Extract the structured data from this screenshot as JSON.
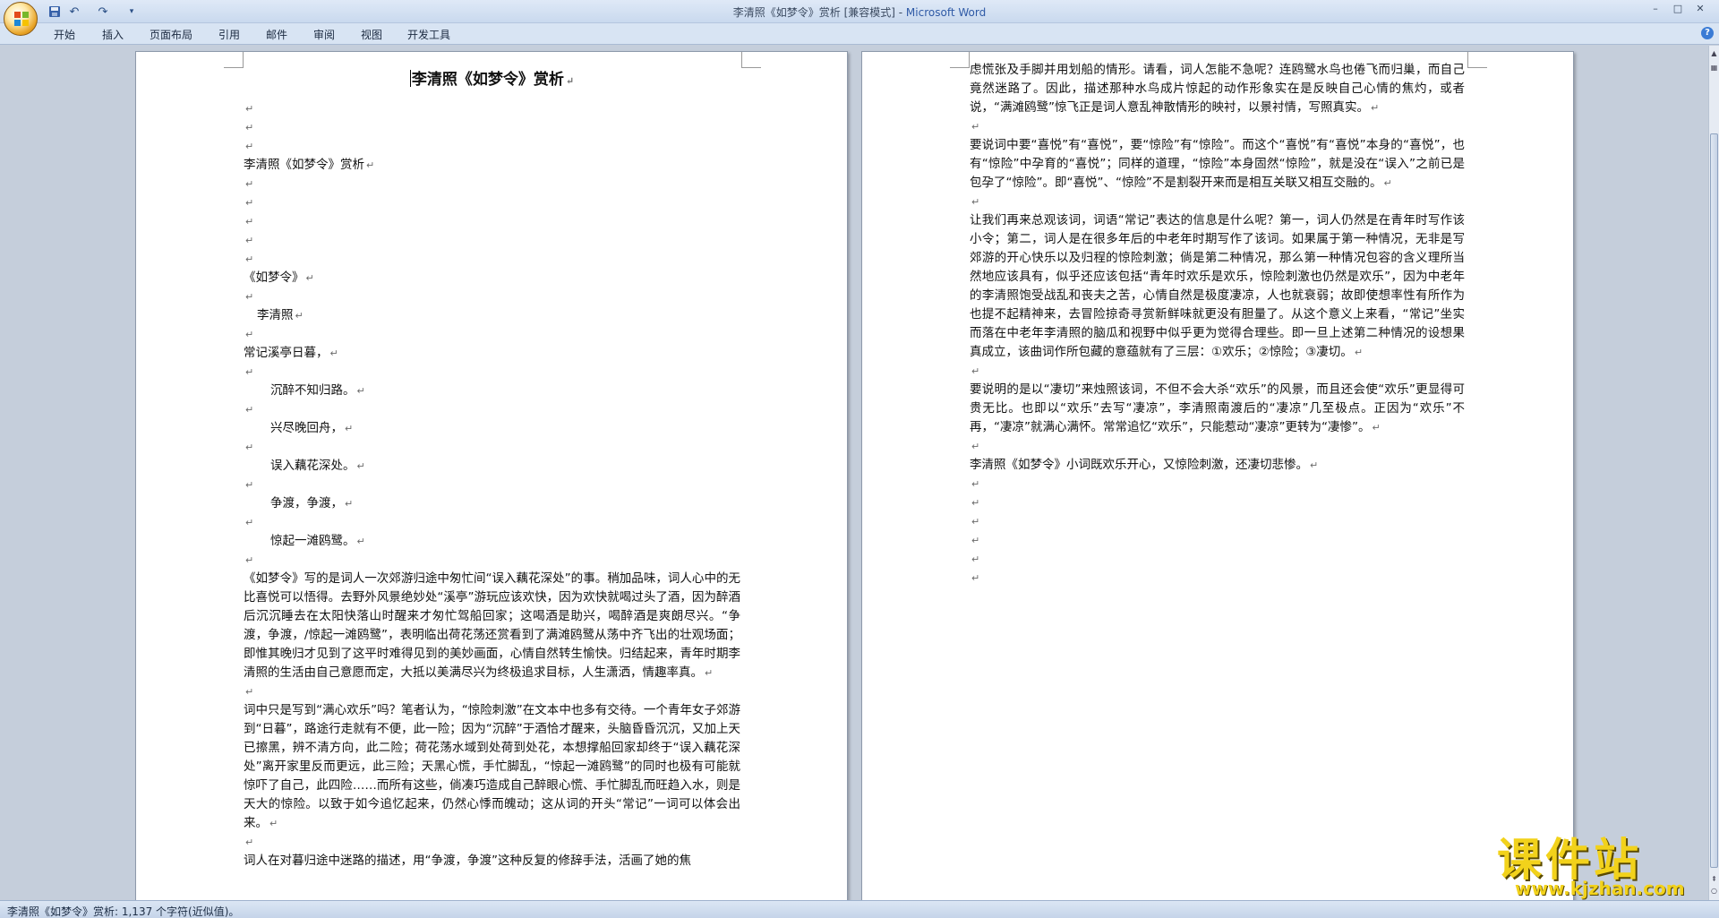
{
  "window": {
    "title": "李清照《如梦令》赏析 [兼容模式] - ",
    "app_name": "Microsoft Word",
    "min": "–",
    "max": "□",
    "close": "✕"
  },
  "quick_access": {
    "save_icon": "save-icon",
    "undo_icon": "undo-icon",
    "redo_icon": "redo-icon"
  },
  "tabs": [
    "开始",
    "插入",
    "页面布局",
    "引用",
    "邮件",
    "审阅",
    "视图",
    "开发工具"
  ],
  "document": {
    "heading": "李清照《如梦令》赏析",
    "subtitle_line": "李清照《如梦令》赏析",
    "poem_title": "《如梦令》",
    "author": "李清照",
    "poem_lines": [
      "常记溪亭日暮，",
      "沉醉不知归路。",
      "兴尽晚回舟，",
      "误入藕花深处。",
      "争渡，争渡，",
      "惊起一滩鸥鹭。"
    ],
    "para1": "《如梦令》写的是词人一次郊游归途中匆忙间“误入藕花深处”的事。稍加品味，词人心中的无比喜悦可以悟得。去野外风景绝妙处“溪亭”游玩应该欢快，因为欢快就喝过头了酒，因为醉酒后沉沉睡去在太阳快落山时醒来才匆忙驾船回家；这喝酒是助兴，喝醉酒是爽朗尽兴。“争渡，争渡，/惊起一滩鸥鹭”，表明临出荷花荡还赏看到了满滩鸥鹭从荡中齐飞出的壮观场面；即惟其晚归才见到了这平时难得见到的美妙画面，心情自然转生愉快。归结起来，青年时期李清照的生活由自己意愿而定，大抵以美满尽兴为终极追求目标，人生潇洒，情趣率真。",
    "para2": "词中只是写到“满心欢乐”吗？笔者认为，“惊险刺激”在文本中也多有交待。一个青年女子郊游到“日暮”，路途行走就有不便，此一险；因为“沉醉”于酒恰才醒来，头脑昏昏沉沉，又加上天已擦黑，辨不清方向，此二险；荷花荡水域到处荷到处花，本想撑船回家却终于“误入藕花深处”离开家里反而更远，此三险；天黑心慌，手忙脚乱，“惊起一滩鸥鹭”的同时也极有可能就惊吓了自己，此四险……而所有这些，倘凑巧造成自己醉眼心慌、手忙脚乱而旺趋入水，则是天大的惊险。以致于如今追忆起来，仍然心悸而魄动；这从词的开头“常记”一词可以体会出来。",
    "para3": "词人在对暮归途中迷路的描述，用“争渡，争渡”这种反复的修辞手法，活画了她的焦",
    "right_para0": "虑慌张及手脚并用划船的情形。请看，词人怎能不急呢？连鸥鹭水鸟也倦飞而归巢，而自己竟然迷路了。因此，描述那种水鸟成片惊起的动作形象实在是反映自己心情的焦灼，或者说，“满滩鸥鹭”惊飞正是词人意乱神散情形的映衬，以景衬情，写照真实。",
    "right_para1": "要说词中要“喜悦”有“喜悦”，要“惊险”有“惊险”。而这个“喜悦”有“喜悦”本身的“喜悦”，也有“惊险”中孕育的“喜悦”；同样的道理，“惊险”本身固然“惊险”，就是没在“误入”之前已是包孕了“惊险”。即“喜悦”、“惊险”不是割裂开来而是相互关联又相互交融的。",
    "right_para2": "让我们再来总观该词，词语“常记”表达的信息是什么呢？第一，词人仍然是在青年时写作该小令；第二，词人是在很多年后的中老年时期写作了该词。如果属于第一种情况，无非是写郊游的开心快乐以及归程的惊险刺激；倘是第二种情况，那么第一种情况包容的含义理所当然地应该具有，似乎还应该包括“青年时欢乐是欢乐，惊险刺激也仍然是欢乐”，因为中老年的李清照饱受战乱和丧夫之苦，心情自然是极度凄凉，人也就衰弱；故即使想率性有所作为也提不起精神来，去冒险掠奇寻赏新鲜味就更没有胆量了。从这个意义上来看，“常记”坐实而落在中老年李清照的脑瓜和视野中似乎更为觉得合理些。即一旦上述第二种情况的设想果真成立，该曲词作所包藏的意蕴就有了三层：①欢乐；②惊险；③凄切。",
    "right_para3": "要说明的是以“凄切”来烛照该词，不但不会大杀“欢乐”的风景，而且还会使“欢乐”更显得可贵无比。也即以“欢乐”去写“凄凉”，李清照南渡后的“凄凉”几至极点。正因为“欢乐”不再，“凄凉”就满心满怀。常常追忆“欢乐”，只能惹动“凄凉”更转为“凄惨”。",
    "right_para4": "李清照《如梦令》小词既欢乐开心，又惊险刺激，还凄切悲惨。"
  },
  "status": {
    "text": "李清照《如梦令》赏析: 1,137 个字符(近似值)。"
  },
  "watermark": {
    "title": "课件站",
    "url": "www.kjzhan.com"
  }
}
